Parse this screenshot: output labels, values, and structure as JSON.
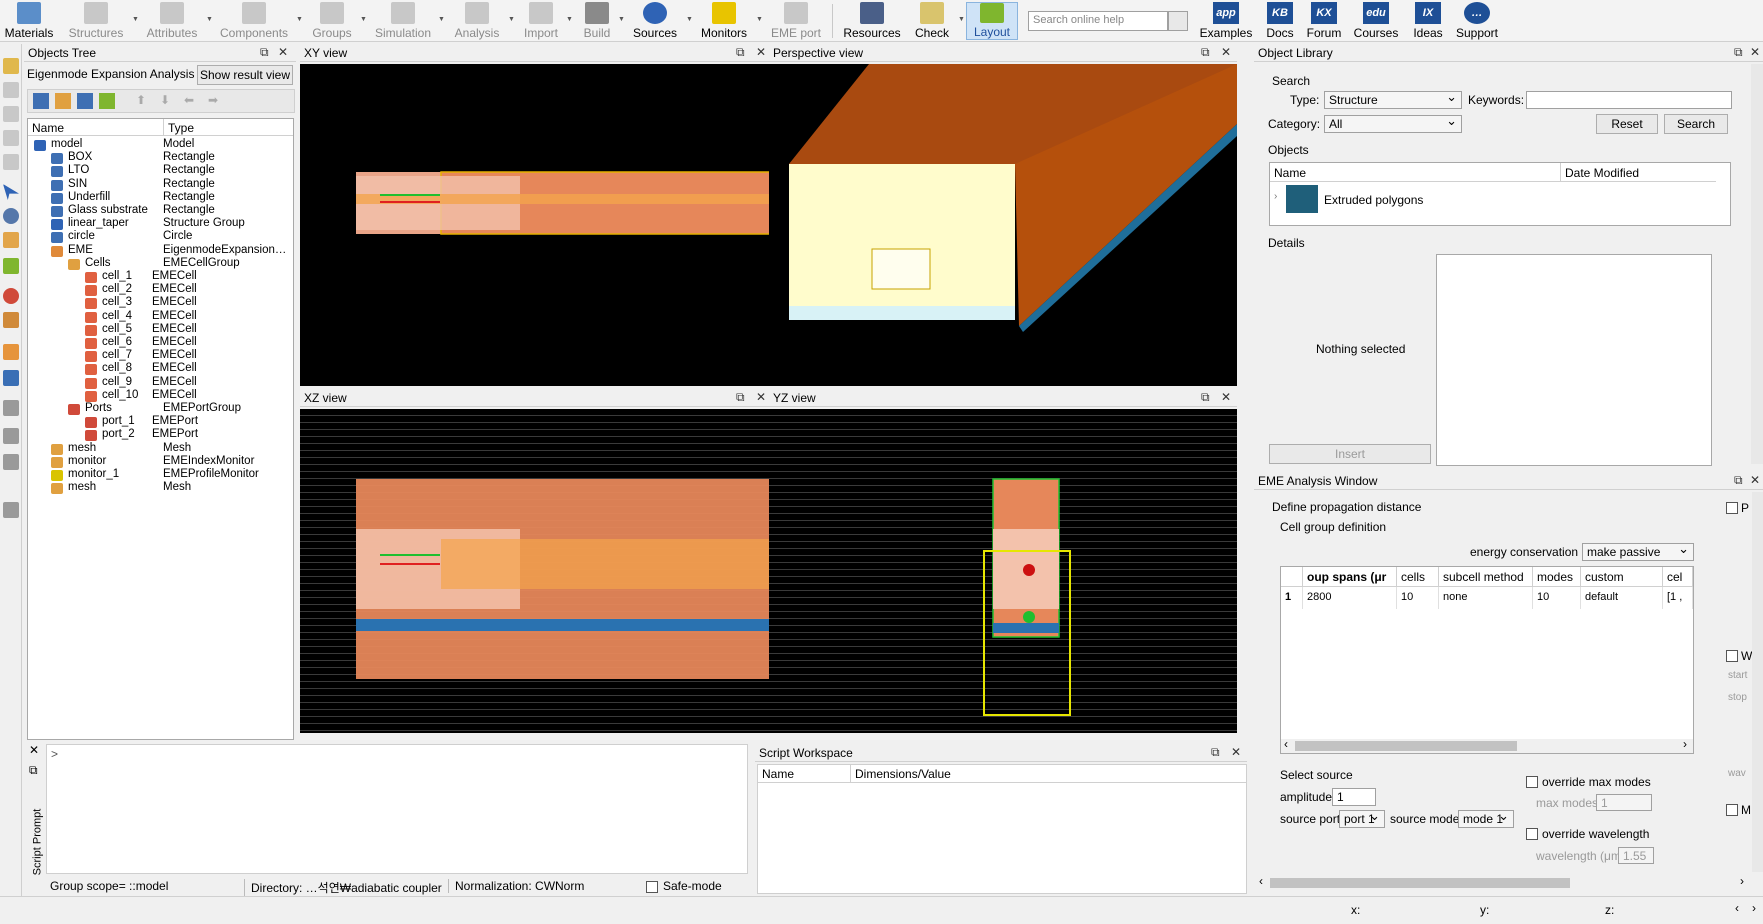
{
  "toolbar": {
    "items": [
      {
        "label": "Materials",
        "icon": "materials-icon"
      },
      {
        "label": "Structures",
        "icon": "structures-icon"
      },
      {
        "label": "Attributes",
        "icon": "attributes-icon"
      },
      {
        "label": "Components",
        "icon": "components-icon"
      },
      {
        "label": "Groups",
        "icon": "groups-icon"
      },
      {
        "label": "Simulation",
        "icon": "simulation-icon"
      },
      {
        "label": "Analysis",
        "icon": "analysis-icon"
      },
      {
        "label": "Import",
        "icon": "import-icon"
      },
      {
        "label": "Build",
        "icon": "build-icon"
      },
      {
        "label": "Sources",
        "icon": "sources-icon"
      },
      {
        "label": "Monitors",
        "icon": "monitors-icon"
      },
      {
        "label": "EME port",
        "icon": "eme-port-icon"
      },
      {
        "label": "Resources",
        "icon": "resources-icon"
      },
      {
        "label": "Check",
        "icon": "check-icon"
      },
      {
        "label": "Layout",
        "icon": "layout-icon"
      }
    ],
    "help_placeholder": "Search online help",
    "links": [
      {
        "label": "Examples",
        "logo": "app"
      },
      {
        "label": "Docs",
        "logo": "KB"
      },
      {
        "label": "Forum",
        "logo": "KX"
      },
      {
        "label": "Courses",
        "logo": "edu"
      },
      {
        "label": "Ideas",
        "logo": "IX"
      },
      {
        "label": "Support",
        "logo": "chat"
      }
    ]
  },
  "objects_tree": {
    "title": "Objects Tree",
    "analysis_label": "Eigenmode Expansion Analysis",
    "show_result_button": "Show result view",
    "col_name": "Name",
    "col_type": "Type",
    "rows": [
      {
        "name": "model",
        "type": "Model"
      },
      {
        "name": "BOX",
        "type": "Rectangle"
      },
      {
        "name": "LTO",
        "type": "Rectangle"
      },
      {
        "name": "SIN",
        "type": "Rectangle"
      },
      {
        "name": "Underfill",
        "type": "Rectangle"
      },
      {
        "name": "Glass substrate",
        "type": "Rectangle"
      },
      {
        "name": "linear_taper",
        "type": "Structure Group"
      },
      {
        "name": "circle",
        "type": "Circle"
      },
      {
        "name": "EME",
        "type": "EigenmodeExpansion…"
      },
      {
        "name": "Cells",
        "type": "EMECellGroup"
      },
      {
        "name": "cell_1",
        "type": "EMECell"
      },
      {
        "name": "cell_2",
        "type": "EMECell"
      },
      {
        "name": "cell_3",
        "type": "EMECell"
      },
      {
        "name": "cell_4",
        "type": "EMECell"
      },
      {
        "name": "cell_5",
        "type": "EMECell"
      },
      {
        "name": "cell_6",
        "type": "EMECell"
      },
      {
        "name": "cell_7",
        "type": "EMECell"
      },
      {
        "name": "cell_8",
        "type": "EMECell"
      },
      {
        "name": "cell_9",
        "type": "EMECell"
      },
      {
        "name": "cell_10",
        "type": "EMECell"
      },
      {
        "name": "Ports",
        "type": "EMEPortGroup"
      },
      {
        "name": "port_1",
        "type": "EMEPort"
      },
      {
        "name": "port_2",
        "type": "EMEPort"
      },
      {
        "name": "mesh",
        "type": "Mesh"
      },
      {
        "name": "monitor",
        "type": "EMEIndexMonitor"
      },
      {
        "name": "monitor_1",
        "type": "EMEProfileMonitor"
      },
      {
        "name": "mesh",
        "type": "Mesh"
      }
    ]
  },
  "views": {
    "xy": "XY view",
    "perspective": "Perspective view",
    "xz": "XZ view",
    "yz": "YZ view"
  },
  "script_prompt": {
    "title": "Script Prompt",
    "prompt": ">"
  },
  "script_workspace": {
    "title": "Script Workspace",
    "col_name": "Name",
    "col_value": "Dimensions/Value"
  },
  "statusbar": {
    "scope": "Group scope= ::model",
    "directory": "Directory: …석연₩adiabatic coupler",
    "normalization": "Normalization: CWNorm",
    "safe_mode": "Safe-mode",
    "x": "x:",
    "y": "y:",
    "z": "z:"
  },
  "object_library": {
    "title": "Object Library",
    "search_label": "Search",
    "type_label": "Type:",
    "type_value": "Structure",
    "keywords_label": "Keywords:",
    "category_label": "Category:",
    "category_value": "All",
    "reset_button": "Reset",
    "search_button": "Search",
    "objects_label": "Objects",
    "col_name": "Name",
    "col_date": "Date Modified",
    "item": "Extruded polygons",
    "details_label": "Details",
    "nothing_selected": "Nothing selected",
    "insert_button": "Insert"
  },
  "eme_window": {
    "title": "EME Analysis Window",
    "propagation": "Define propagation distance",
    "cell_group": "Cell group definition",
    "energy_label": "energy conservation",
    "energy_value": "make passive",
    "table_headers": [
      "oup spans (μr",
      "cells",
      "subcell method",
      "modes",
      "custom",
      "cel"
    ],
    "table_row": {
      "index": "1",
      "spans": "2800",
      "cells": "10",
      "subcell": "none",
      "modes": "10",
      "custom": "default",
      "cel": "[1 ,"
    },
    "select_source": "Select source",
    "amplitude_label": "amplitude",
    "amplitude_value": "1",
    "source_port_label": "source port",
    "source_port_value": "port 1",
    "source_mode_label": "source mode",
    "source_mode_value": "mode 1",
    "override_max_modes": "override max modes",
    "max_modes_label": "max modes",
    "max_modes_value": "1",
    "override_wavelength": "override wavelength",
    "wavelength_label": "wavelength (μm)",
    "wavelength_value": "1.55",
    "side_labels": [
      "P",
      "W",
      "start",
      "stop",
      "wav",
      "M"
    ]
  }
}
